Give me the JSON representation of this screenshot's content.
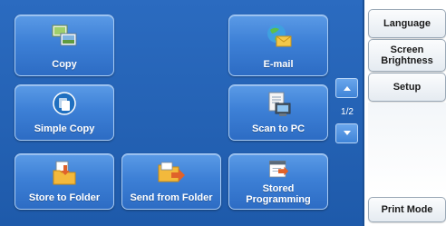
{
  "apps": [
    {
      "id": "copy",
      "label": "Copy",
      "icon": "copy-icon"
    },
    {
      "id": "email",
      "label": "E-mail",
      "icon": "email-icon"
    },
    {
      "id": "simple-copy",
      "label": "Simple Copy",
      "icon": "simple-copy-icon"
    },
    {
      "id": "scan-to-pc",
      "label": "Scan to PC",
      "icon": "scan-to-pc-icon"
    },
    {
      "id": "store-to-folder",
      "label": "Store to Folder",
      "icon": "store-to-folder-icon"
    },
    {
      "id": "send-from-folder",
      "label": "Send from Folder",
      "icon": "send-from-folder-icon"
    },
    {
      "id": "stored-programming",
      "label": "Stored\nProgramming",
      "icon": "stored-programming-icon"
    }
  ],
  "pager": {
    "page_label": "1/2",
    "up_icon": "arrow-up-icon",
    "down_icon": "arrow-down-icon"
  },
  "side": {
    "language": "Language",
    "screen_brightness": "Screen\nBrightness",
    "setup": "Setup",
    "print_mode": "Print Mode"
  },
  "colors": {
    "panel": "#1e5aaa",
    "button": "#3d80d6",
    "side": "#ffffff"
  }
}
